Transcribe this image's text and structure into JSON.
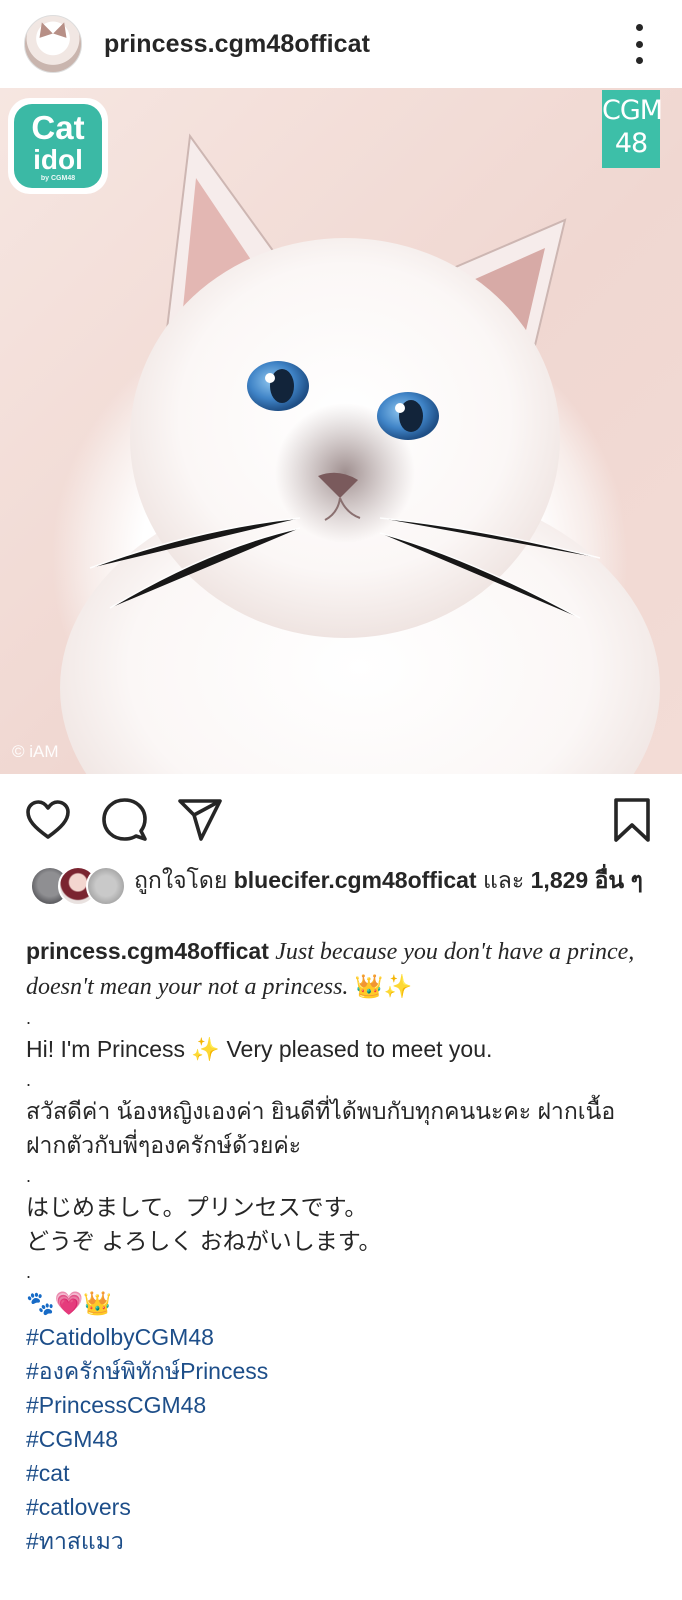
{
  "post": {
    "username": "princess.cgm48officat",
    "photo": {
      "logo_left": {
        "line1": "Cat",
        "line2": "idol",
        "line3": "by CGM48"
      },
      "logo_right": {
        "line1": "CGM",
        "line2": "48"
      },
      "credit": "© iAM"
    }
  },
  "liked_by": {
    "prefix": "ถูกใจโดย",
    "user": "bluecifer.cgm48officat",
    "conjunction": "และ",
    "count": "1,829",
    "suffix": "อื่น ๆ"
  },
  "caption": {
    "owner": "princess.cgm48officat",
    "quote": "Just because you don't have a prince, doesn't mean your not a princess.",
    "quote_emoji": "👑✨",
    "separator": ".",
    "english_1": "Hi! I'm Princess",
    "english_sparkle": "✨",
    "english_2": "Very pleased to meet you.",
    "thai": "สวัสดีค่า น้องหญิงเองค่า ยินดีที่ได้พบกับทุกคนนะคะ ฝากเนื้อฝากตัวกับพี่ๆองครักษ์ด้วยค่ะ",
    "japanese_1": "はじめまして。プリンセスです。",
    "japanese_2": "どうぞ よろしく おねがいします。",
    "emoji_line": "🐾💗👑",
    "hashtags": [
      "#CatidolbyCGM48",
      "#องครักษ์พิทักษ์Princess",
      "#PrincessCGM48",
      "#CGM48",
      "#cat",
      "#catlovers",
      "#ทาสแมว"
    ]
  },
  "colors": {
    "accent_teal": "#3bb9a5",
    "hashtag_blue": "#1d4e89",
    "text": "#262626"
  }
}
